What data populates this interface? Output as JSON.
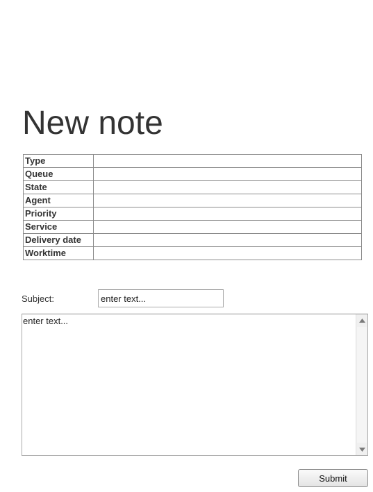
{
  "page": {
    "title": "New note"
  },
  "properties": [
    {
      "label": "Type",
      "value": ""
    },
    {
      "label": "Queue",
      "value": ""
    },
    {
      "label": "State",
      "value": ""
    },
    {
      "label": "Agent",
      "value": ""
    },
    {
      "label": "Priority",
      "value": ""
    },
    {
      "label": "Service",
      "value": ""
    },
    {
      "label": "Delivery date",
      "value": ""
    },
    {
      "label": "Worktime",
      "value": ""
    }
  ],
  "form": {
    "subject_label": "Subject:",
    "subject_value": "enter text...",
    "body_text": "enter text...",
    "submit_label": "Submit"
  },
  "icons": {
    "scroll_up": "triangle-up-icon",
    "scroll_down": "triangle-down-icon"
  }
}
